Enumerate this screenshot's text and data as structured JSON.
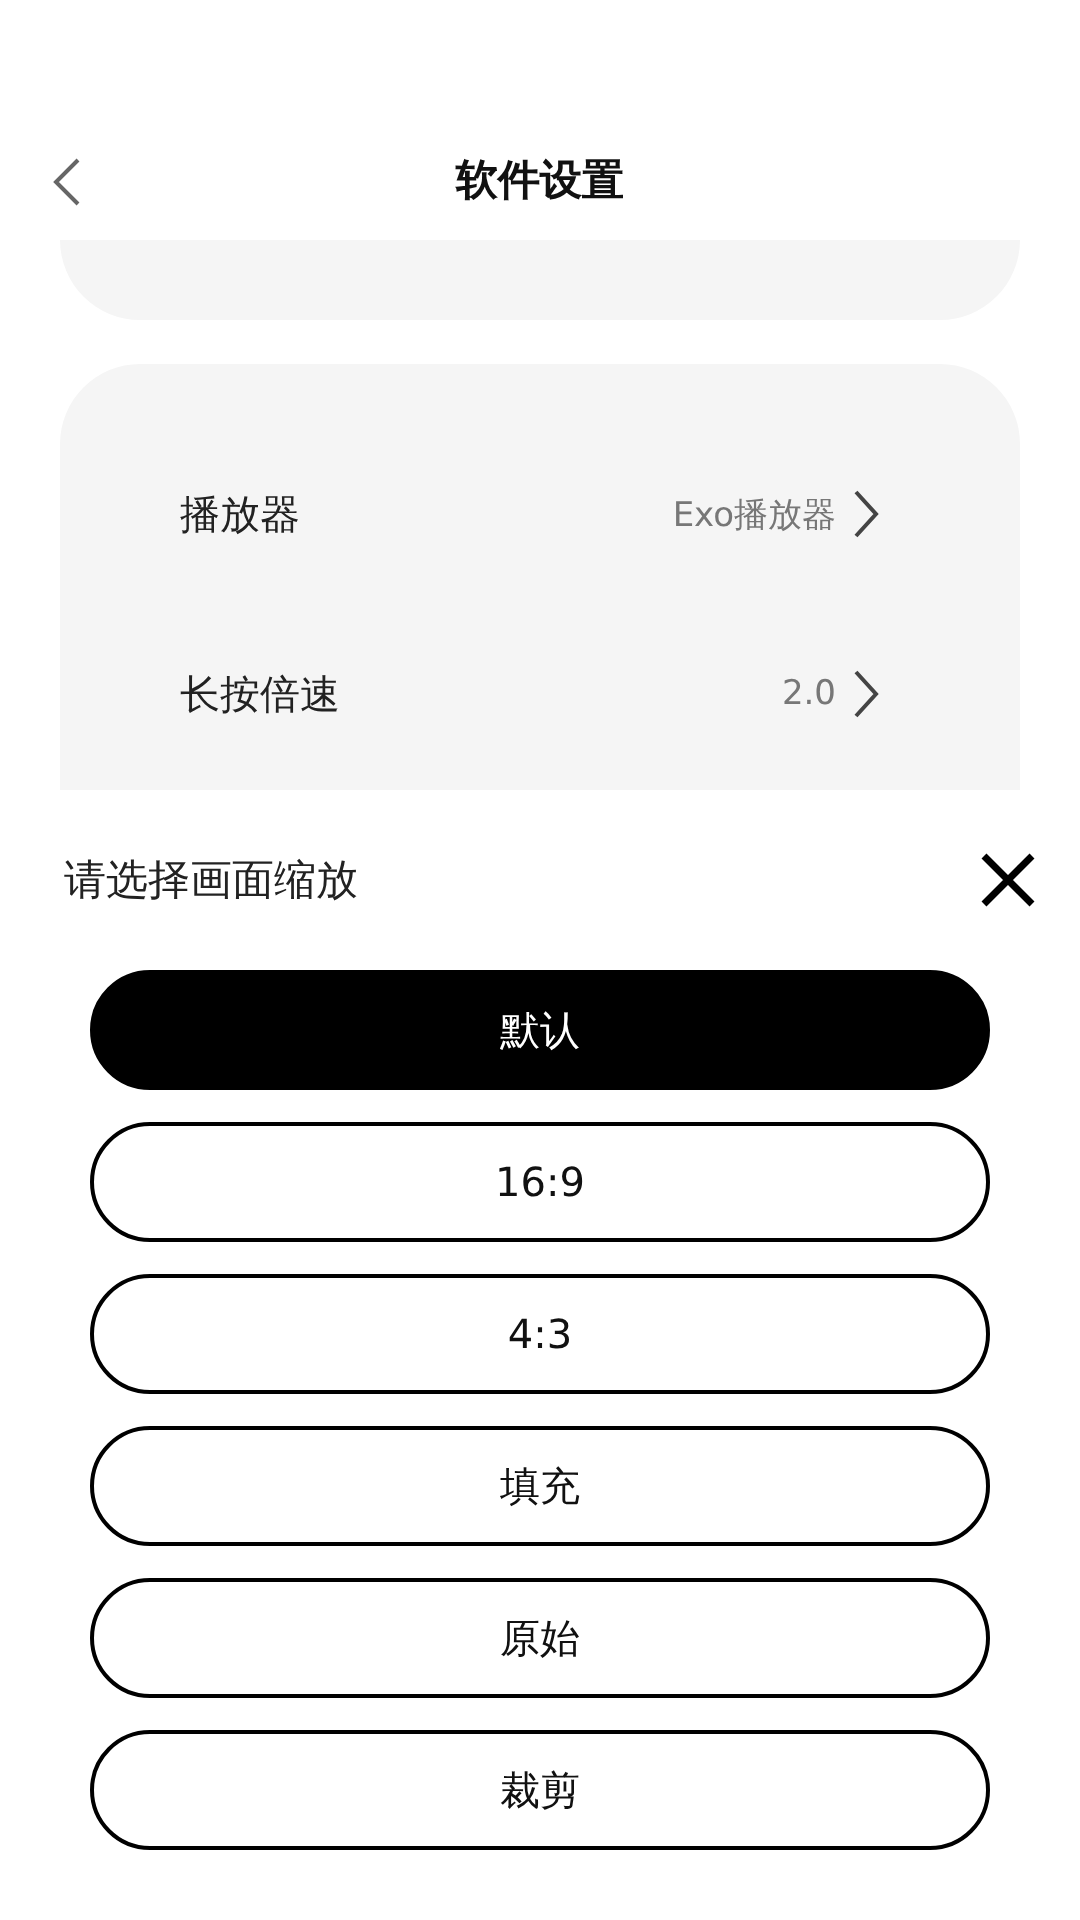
{
  "header": {
    "title": "软件设置"
  },
  "settings": [
    {
      "label": "播放器",
      "value": "Exo播放器"
    },
    {
      "label": "长按倍速",
      "value": "2.0"
    }
  ],
  "sheet": {
    "title": "请选择画面缩放",
    "options": [
      {
        "label": "默认",
        "selected": true
      },
      {
        "label": "16:9",
        "selected": false
      },
      {
        "label": "4:3",
        "selected": false
      },
      {
        "label": "填充",
        "selected": false
      },
      {
        "label": "原始",
        "selected": false
      },
      {
        "label": "裁剪",
        "selected": false
      }
    ]
  }
}
